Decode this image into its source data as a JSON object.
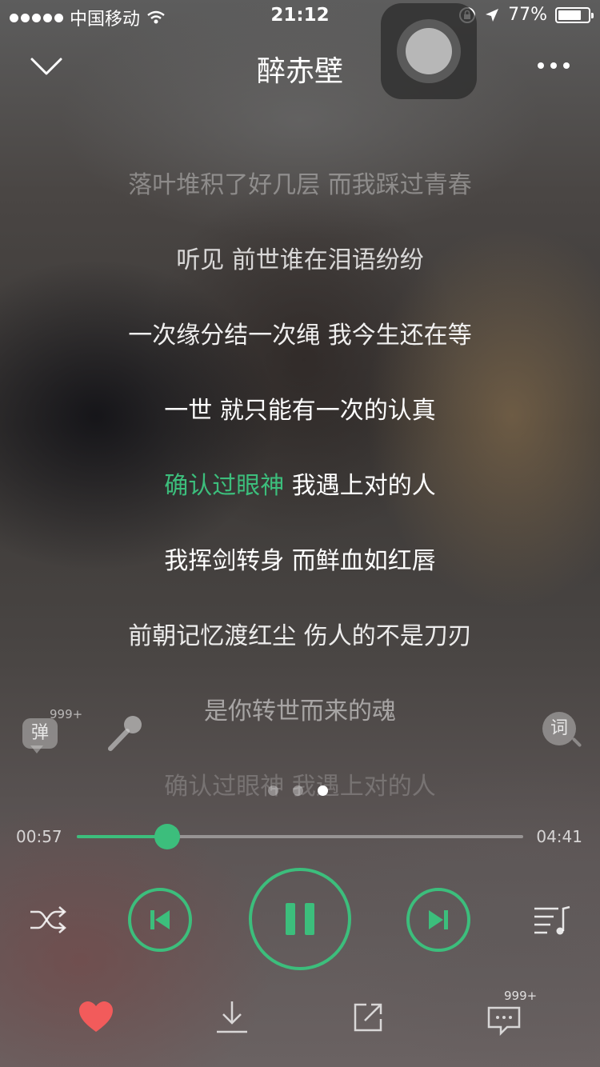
{
  "status_bar": {
    "carrier": "中国移动",
    "time": "21:12",
    "battery": "77%",
    "battery_level": 0.77
  },
  "header": {
    "title": "醉赤壁"
  },
  "lyrics": {
    "faded_top": "落叶堆积了好几层 而我踩过青春",
    "lines": [
      "听见 前世谁在泪语纷纷",
      "一次缘分结一次绳 我今生还在等",
      "一世 就只能有一次的认真"
    ],
    "current_sung": "确认过眼神",
    "current_rest": " 我遇上对的人",
    "after": [
      "我挥剑转身 而鲜血如红唇",
      "前朝记忆渡红尘 伤人的不是刀刃"
    ],
    "faded_bottom_1": "是你转世而来的魂",
    "faded_bottom_2": "确认过眼神 我遇上对的人"
  },
  "side": {
    "danmu_label": "弹",
    "danmu_badge": "999+",
    "lyric_label": "词"
  },
  "pager": {
    "count": 3,
    "active": 2
  },
  "player": {
    "current_time": "00:57",
    "duration": "04:41",
    "progress": 0.203
  },
  "bottom": {
    "comment_badge": "999+"
  },
  "colors": {
    "accent": "#3cbe7c",
    "heart": "#f25b5b"
  }
}
